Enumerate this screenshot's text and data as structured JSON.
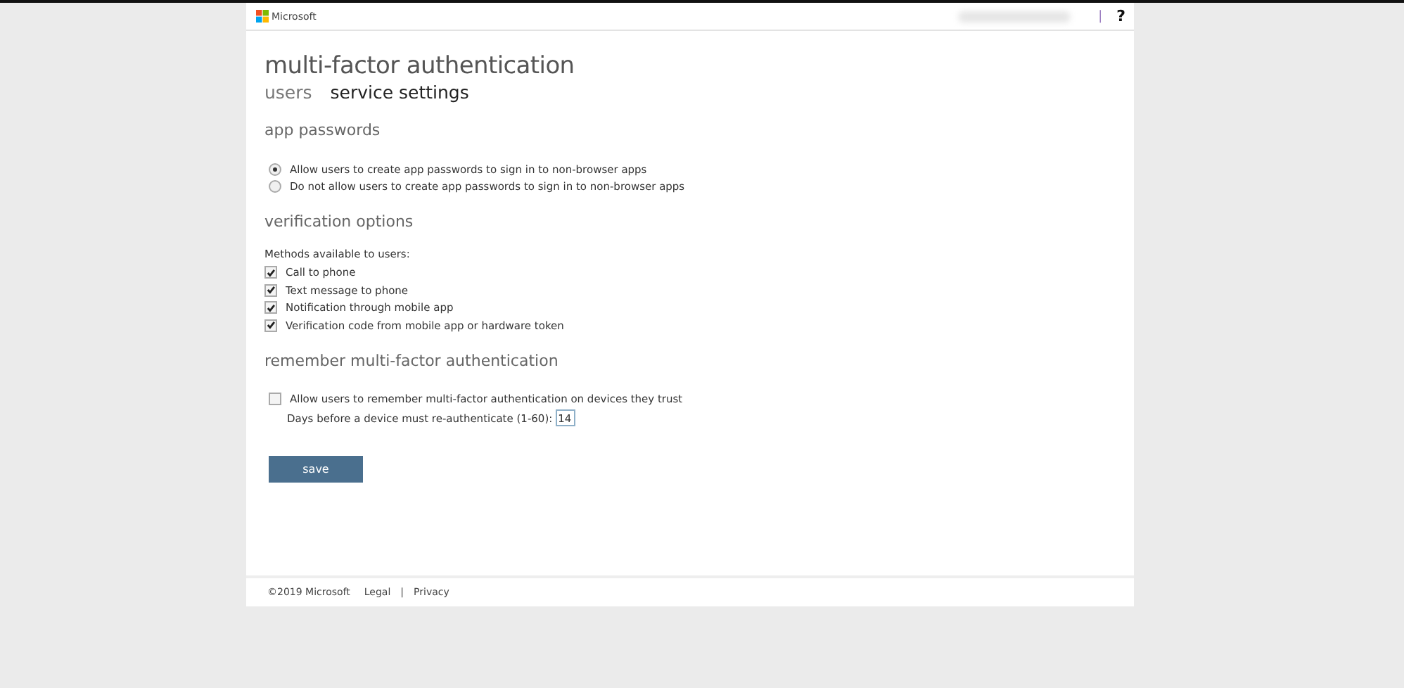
{
  "header": {
    "brand": "Microsoft",
    "separator": "|",
    "help": "?"
  },
  "title": "multi-factor authentication",
  "tabs": [
    {
      "label": "users",
      "selected": false
    },
    {
      "label": "service settings",
      "selected": true
    }
  ],
  "app_passwords": {
    "heading": "app passwords",
    "options": [
      {
        "label": "Allow users to create app passwords to sign in to non-browser apps",
        "selected": true
      },
      {
        "label": "Do not allow users to create app passwords to sign in to non-browser apps",
        "selected": false
      }
    ]
  },
  "verification_options": {
    "heading": "verification options",
    "intro": "Methods available to users:",
    "methods": [
      {
        "label": "Call to phone",
        "checked": true
      },
      {
        "label": "Text message to phone",
        "checked": true
      },
      {
        "label": "Notification through mobile app",
        "checked": true
      },
      {
        "label": "Verification code from mobile app or hardware token",
        "checked": true
      }
    ]
  },
  "remember": {
    "heading": "remember multi-factor authentication",
    "option": {
      "label": "Allow users to remember multi-factor authentication on devices they trust",
      "checked": false
    },
    "days_label": "Days before a device must re-authenticate (1-60):",
    "days_value": "14"
  },
  "save_button": "save",
  "footer": {
    "copyright": "©2019 Microsoft",
    "links": [
      "Legal",
      "Privacy"
    ],
    "separator": "|"
  }
}
